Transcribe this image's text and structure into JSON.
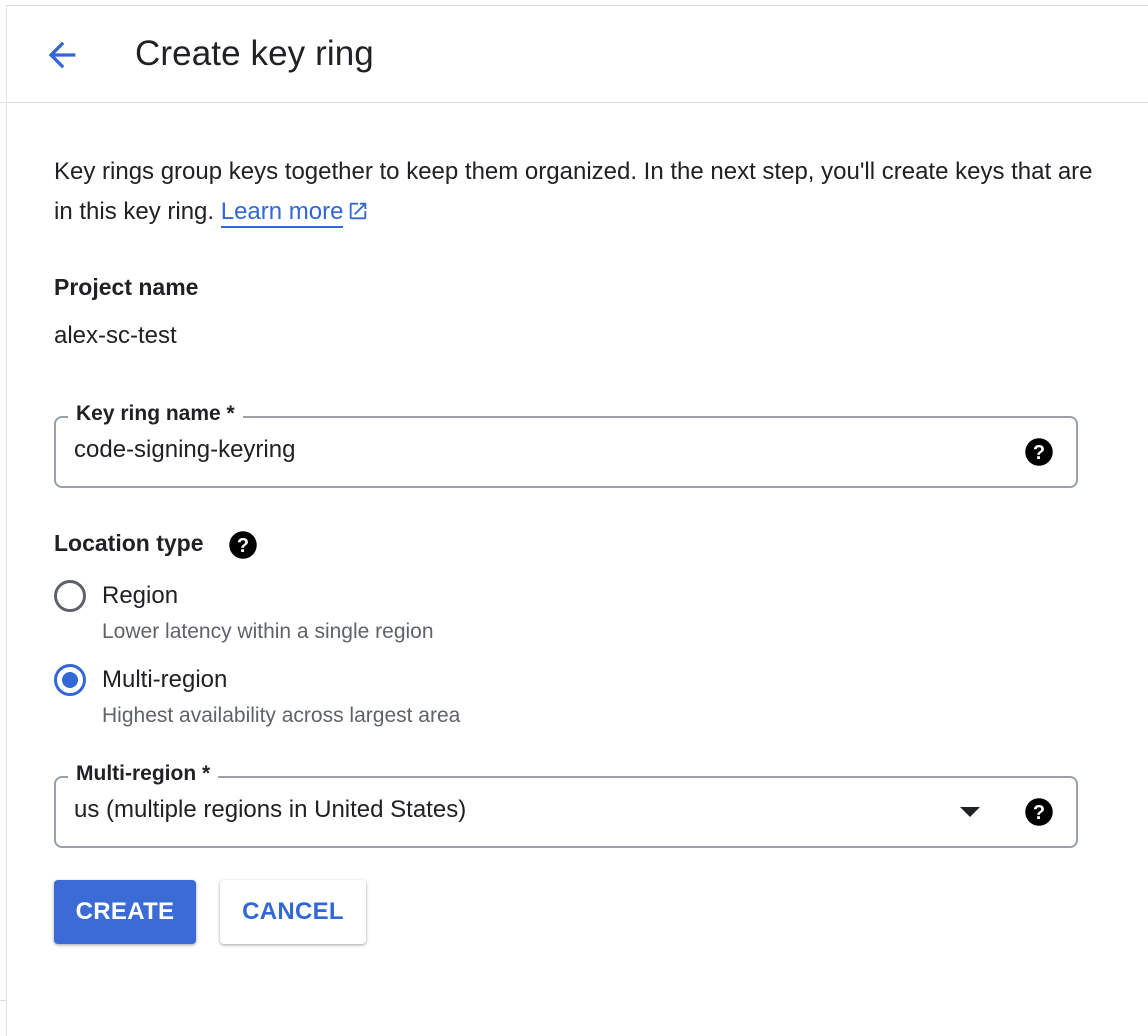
{
  "header": {
    "title": "Create key ring",
    "back_icon": "arrow-back-icon"
  },
  "intro": {
    "text": "Key rings group keys together to keep them organized. In the next step, you'll create keys that are in this key ring.",
    "learn_more": "Learn more",
    "link_icon": "open-in-new-icon"
  },
  "project": {
    "label": "Project name",
    "value": "alex-sc-test"
  },
  "key_ring_name": {
    "label": "Key ring name *",
    "value": "code-signing-keyring",
    "help_icon": "help-icon"
  },
  "location_type": {
    "label": "Location type",
    "help_icon": "help-icon",
    "selected": "Multi-region",
    "options": [
      {
        "label": "Region",
        "description": "Lower latency within a single region"
      },
      {
        "label": "Multi-region",
        "description": "Highest availability across largest area"
      }
    ]
  },
  "multi_region": {
    "label": "Multi-region *",
    "value": "us (multiple regions in United States)",
    "help_icon": "help-icon"
  },
  "actions": {
    "create": "CREATE",
    "cancel": "CANCEL"
  },
  "colors": {
    "accent": "#3367d6",
    "primary_button": "#3b6cd6",
    "border": "#9aa0a6",
    "divider": "#dadce0",
    "secondary_text": "#5f6368"
  }
}
